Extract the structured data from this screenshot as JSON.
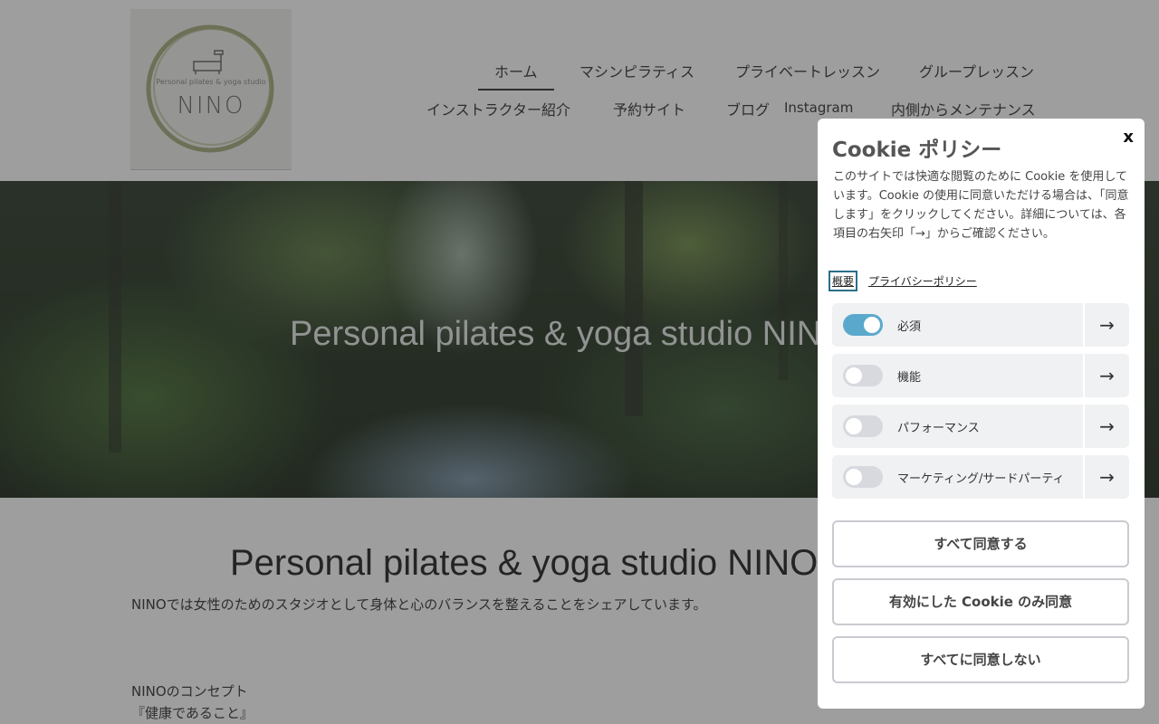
{
  "logo": {
    "subtitle": "Personal pilates & yoga studio",
    "name": "NINO"
  },
  "nav": {
    "items": [
      {
        "label": "ホーム"
      },
      {
        "label": "マシンピラティス"
      },
      {
        "label": "プライベートレッスン"
      },
      {
        "label": "グループレッスン"
      },
      {
        "label": "インストラクター紹介"
      },
      {
        "label": "予約サイト"
      },
      {
        "label": "ブログ"
      },
      {
        "label": "Instagram"
      },
      {
        "label": "内側からメンテナンス"
      }
    ]
  },
  "hero": {
    "title": "Personal pilates & yoga studio NINO"
  },
  "content": {
    "title": "Personal pilates & yoga studio NINO",
    "intro": "NINOでは女性のためのスタジオとして身体と心のバランスを整えることをシェアしています。",
    "concept_label": "NINOのコンセプト",
    "concept_value": "『健康であること』"
  },
  "cookie": {
    "title": "Cookie ポリシー",
    "close": "x",
    "description": "このサイトでは快適な閲覧のために Cookie を使用しています。Cookie の使用に同意いただける場合は、「同意します」をクリックしてください。詳細については、各項目の右矢印「→」からご確認ください。",
    "tabs": [
      {
        "label": "概要"
      },
      {
        "label": "プライバシーポリシー"
      }
    ],
    "categories": [
      {
        "label": "必須",
        "enabled": true
      },
      {
        "label": "機能",
        "enabled": false
      },
      {
        "label": "パフォーマンス",
        "enabled": false
      },
      {
        "label": "マーケティング/サードパーティ",
        "enabled": false
      }
    ],
    "arrow": "→",
    "buttons": {
      "accept_all": "すべて同意する",
      "accept_selected": "有効にした Cookie のみ同意",
      "reject_all": "すべてに同意しない"
    }
  }
}
